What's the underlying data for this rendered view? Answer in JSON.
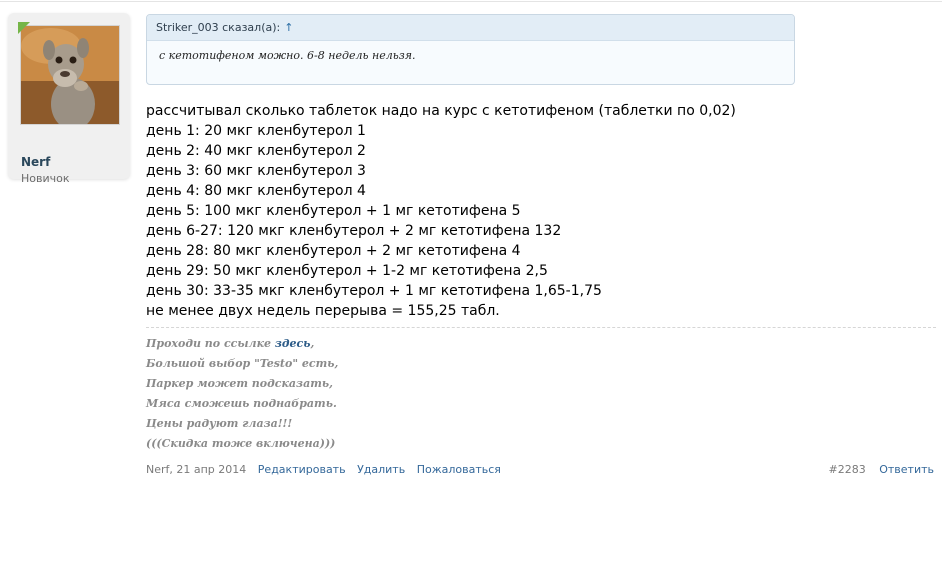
{
  "user": {
    "name": "Nerf",
    "title": "Новичок"
  },
  "quote": {
    "author_line": "Striker_003 сказал(а):",
    "arrow": "↑",
    "text": "с кетотифеном можно. 6-8 недель нельзя."
  },
  "message": {
    "lines": [
      "рассчитывал сколько таблеток надо на курс с кетотифеном (таблетки по 0,02)",
      "день 1: 20 мкг кленбутерол 1",
      "день 2: 40 мкг кленбутерол 2",
      "день 3: 60 мкг кленбутерол 3",
      "день 4: 80 мкг кленбутерол 4",
      "день 5: 100 мкг кленбутерол + 1 мг кетотифена 5",
      "день 6-27: 120 мкг кленбутерол + 2 мг кетотифена 132",
      "день 28: 80 мкг кленбутерол + 2 мг кетотифена 4",
      "день 29: 50 мкг кленбутерол + 1-2 мг кетотифена 2,5",
      "день 30: 33-35 мкг кленбутерол + 1 мг кетотифена 1,65-1,75",
      "не менее двух недель перерыва = 155,25 табл."
    ]
  },
  "signature": {
    "line1_prefix": "Проходи по ссылке ",
    "line1_link": "здесь",
    "line1_suffix": ",",
    "line2": "Большой выбор \"Testo\" есть,",
    "line3": "Паркер может подсказать,",
    "line4": "Мяса сможешь поднабрать.",
    "line5": "Цены радуют глаза!!!",
    "line6": "(((Скидка тоже включена)))"
  },
  "footer": {
    "author_date": "Nerf, 21 апр 2014",
    "edit": "Редактировать",
    "delete": "Удалить",
    "report": "Пожаловаться",
    "post_number": "#2283",
    "reply": "Ответить"
  },
  "colors": {
    "link": "#34689a",
    "online": "#75b548",
    "quote_header": "#e2edf6"
  }
}
